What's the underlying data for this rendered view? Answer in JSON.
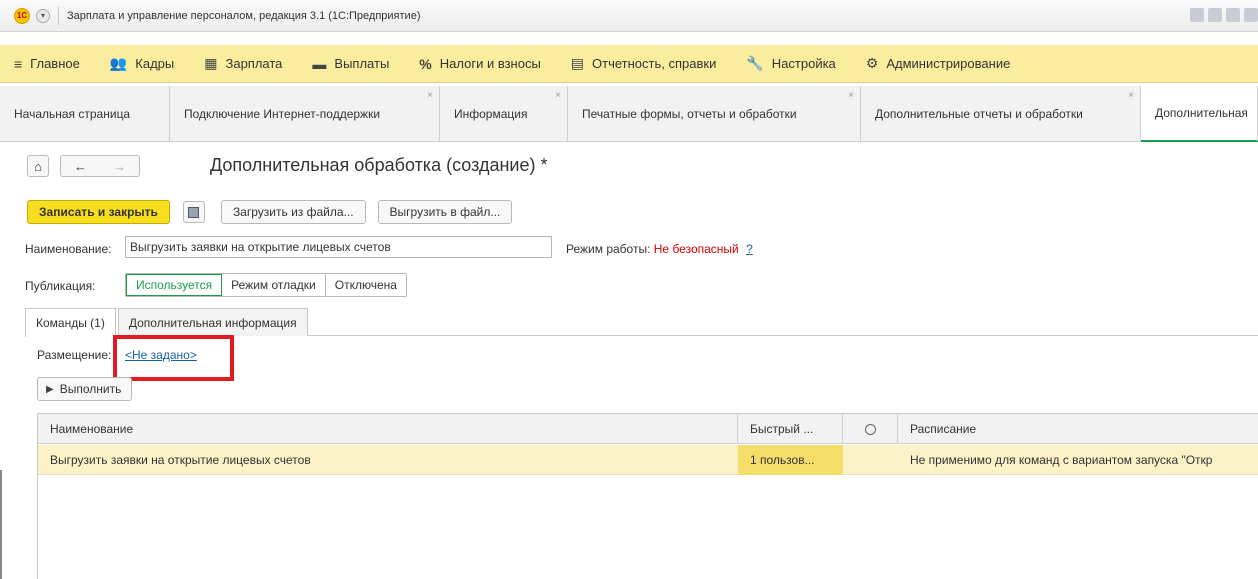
{
  "window": {
    "title": "Зарплата и управление персоналом, редакция 3.1  (1С:Предприятие)"
  },
  "main_menu": [
    {
      "icon": "≡",
      "label": "Главное"
    },
    {
      "icon": "👥",
      "label": "Кадры"
    },
    {
      "icon": "▦",
      "label": "Зарплата"
    },
    {
      "icon": "▬",
      "label": "Выплаты"
    },
    {
      "icon": "%",
      "label": "Налоги и взносы"
    },
    {
      "icon": "▤",
      "label": "Отчетность, справки"
    },
    {
      "icon": "🔧",
      "label": "Настройка"
    },
    {
      "icon": "⚙",
      "label": "Администрирование"
    }
  ],
  "tabs": [
    {
      "label": "Начальная страница"
    },
    {
      "label": "Подключение Интернет-поддержки"
    },
    {
      "label": "Информация"
    },
    {
      "label": "Печатные формы, отчеты и обработки"
    },
    {
      "label": "Дополнительные отчеты и обработки"
    },
    {
      "label": "Дополнительная"
    }
  ],
  "nav": {
    "home": "⌂",
    "back": "←",
    "forward": "→"
  },
  "page": {
    "title": "Дополнительная обработка (создание) *"
  },
  "commands": {
    "save_close": "Записать и закрыть",
    "load_file": "Загрузить из файла...",
    "unload_file": "Выгрузить в файл..."
  },
  "form": {
    "name_label": "Наименование:",
    "name_value": "Выгрузить заявки на открытие лицевых счетов",
    "mode_label": "Режим работы:",
    "mode_value": "Не безопасный",
    "mode_help": "?",
    "publication_label": "Публикация:",
    "publication_options": [
      "Используется",
      "Режим отладки",
      "Отключена"
    ]
  },
  "inner_tabs": [
    {
      "label": "Команды (1)"
    },
    {
      "label": "Дополнительная информация"
    }
  ],
  "placement": {
    "label": "Размещение:",
    "value": "<Не задано>"
  },
  "run_button": "Выполнить",
  "table": {
    "headers": {
      "name": "Наименование",
      "quick": "Быстрый ...",
      "schedule": "Расписание"
    },
    "rows": [
      {
        "name": "Выгрузить заявки на открытие лицевых счетов",
        "quick": "1 пользов...",
        "schedule": "Не применимо для команд с вариантом запуска \"Откр"
      }
    ]
  }
}
